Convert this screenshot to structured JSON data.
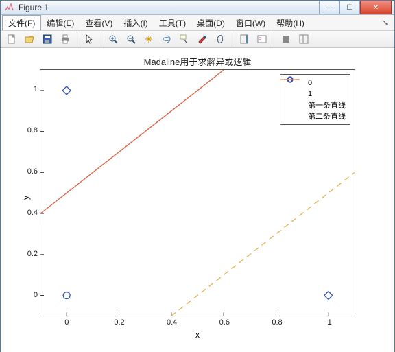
{
  "window": {
    "title": "Figure 1"
  },
  "menu": {
    "items": [
      {
        "label": "文件",
        "hot": "F"
      },
      {
        "label": "编辑",
        "hot": "E"
      },
      {
        "label": "查看",
        "hot": "V"
      },
      {
        "label": "插入",
        "hot": "I"
      },
      {
        "label": "工具",
        "hot": "T"
      },
      {
        "label": "桌面",
        "hot": "D"
      },
      {
        "label": "窗口",
        "hot": "W"
      },
      {
        "label": "帮助",
        "hot": "H"
      }
    ]
  },
  "toolbar": {
    "icons": [
      "new",
      "open",
      "save",
      "print",
      "pointer",
      "zoom-in",
      "zoom-out",
      "pan",
      "rotate3d",
      "datacursor",
      "brush",
      "link",
      "colorbar",
      "legend",
      "hide",
      "dock"
    ]
  },
  "chart_data": {
    "type": "scatter+line",
    "title": "Madaline用于求解异或逻辑",
    "xlabel": "x",
    "ylabel": "y",
    "xlim": [
      -0.1,
      1.1
    ],
    "ylim": [
      -0.1,
      1.1
    ],
    "xticks": [
      0,
      0.2,
      0.4,
      0.6,
      0.8,
      1
    ],
    "yticks": [
      0,
      0.2,
      0.4,
      0.6,
      0.8,
      1
    ],
    "series": [
      {
        "name": "0",
        "type": "scatter",
        "marker": "circle",
        "color": "#2e4fbf",
        "points": [
          [
            0,
            0
          ],
          [
            1,
            1
          ]
        ]
      },
      {
        "name": "1",
        "type": "scatter",
        "marker": "diamond",
        "color": "#2e4fbf",
        "points": [
          [
            0,
            1
          ],
          [
            1,
            0
          ]
        ]
      },
      {
        "name": "第一条直线",
        "type": "line",
        "style": "solid",
        "color": "#d9674a",
        "points": [
          [
            -0.1,
            0.4
          ],
          [
            0.6,
            1.1
          ]
        ]
      },
      {
        "name": "第二条直线",
        "type": "line",
        "style": "dashed",
        "color": "#e6b45a",
        "points": [
          [
            0.4,
            -0.1
          ],
          [
            1.1,
            0.6
          ]
        ]
      }
    ],
    "legend": {
      "position": "top-right",
      "entries": [
        "0",
        "1",
        "第一条直线",
        "第二条直线"
      ]
    }
  }
}
